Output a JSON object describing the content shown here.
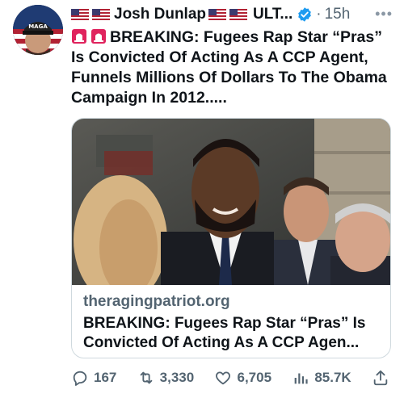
{
  "author": {
    "display_name": "Josh Dunlap",
    "handle_truncated": "ULT...",
    "verified": true,
    "time": "15h",
    "avatar_text": "MAGA"
  },
  "tweet": {
    "text": "BREAKING: Fugees Rap Star “Pras” Is Convicted Of Acting As A CCP Agent, Funnels Millions Of Dollars To The Obama Campaign In 2012....."
  },
  "card": {
    "domain": "theragingpatriot.org",
    "title": "BREAKING: Fugees Rap Star “Pras” Is Convicted Of Acting As A CCP Agen..."
  },
  "actions": {
    "replies": "167",
    "retweets": "3,330",
    "likes": "6,705",
    "views": "85.7K"
  },
  "colors": {
    "verified": "#1d9bf0",
    "muted": "#536471",
    "text": "#0f1419"
  },
  "icons": [
    "more-icon",
    "verified-icon",
    "siren-icon",
    "reply-icon",
    "retweet-icon",
    "like-icon",
    "views-icon",
    "share-icon"
  ]
}
